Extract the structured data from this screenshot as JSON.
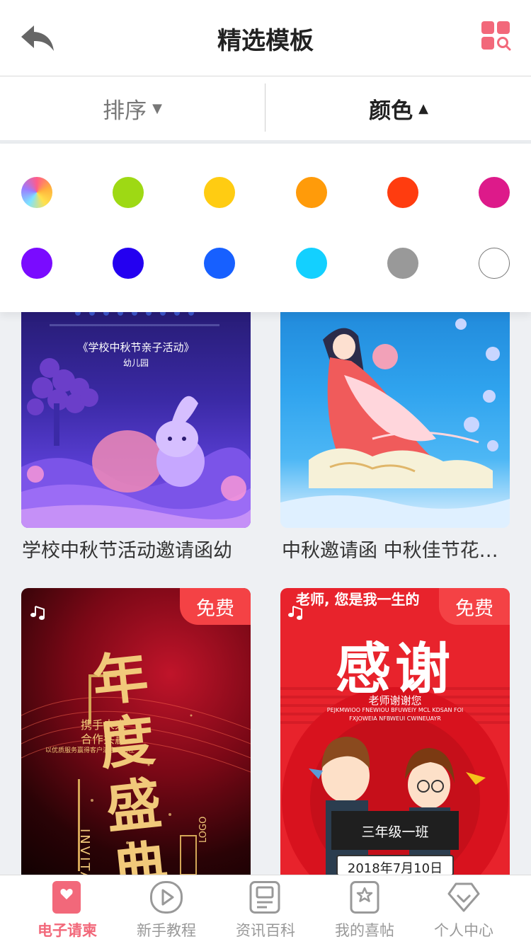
{
  "header": {
    "title": "精选模板",
    "back_icon": "back-arrow-icon",
    "grid_icon": "template-search-icon"
  },
  "filters": {
    "sort": {
      "label": "排序",
      "arrow": "▼"
    },
    "color": {
      "label": "颜色",
      "arrow": "▲"
    }
  },
  "colors": [
    "rainbow",
    "#9ed914",
    "#ffcc12",
    "#ff9b0a",
    "#ff3c0f",
    "#dd1a8a",
    "#7a0bff",
    "#2400f0",
    "#1760ff",
    "#13d0ff",
    "#999999",
    "#ffffff"
  ],
  "templates": [
    {
      "caption": "学校中秋节活动邀请函幼",
      "free": false
    },
    {
      "caption": "中秋邀请函 中秋佳节花…",
      "free": false
    },
    {
      "caption": "",
      "free": true,
      "badge": "免费"
    },
    {
      "caption": "",
      "free": true,
      "badge": "免费"
    }
  ],
  "poster_text": {
    "p1_title": "《学校中秋节亲子活动》",
    "p1_sub": "幼儿园",
    "p3_title": "年度盛典",
    "p3_line1": "携手未来",
    "p3_line2": "合作共赢",
    "p3_line3": "以优质服务赢得客户满意与信任",
    "p3_vert": "INVITATION",
    "p3_logo": "LOGO",
    "p4_top": "老师, 您是我一生的",
    "p4_title": "感谢",
    "p4_sub": "老师谢谢您",
    "p4_en1": "PEJKMWIOO FNEWIOU BFUWEIY MCL KDSAN FOI",
    "p4_en2": "FXJOWEIA NFBWEUI CWINEUAYR",
    "p4_class": "三年级一班",
    "p4_date": "2018年7月10日"
  },
  "tabs": [
    {
      "label": "电子请柬",
      "icon": "heart-card-icon",
      "active": true
    },
    {
      "label": "新手教程",
      "icon": "play-icon",
      "active": false
    },
    {
      "label": "资讯百科",
      "icon": "news-icon",
      "active": false
    },
    {
      "label": "我的喜帖",
      "icon": "star-card-icon",
      "active": false
    },
    {
      "label": "个人中心",
      "icon": "diamond-icon",
      "active": false
    }
  ]
}
